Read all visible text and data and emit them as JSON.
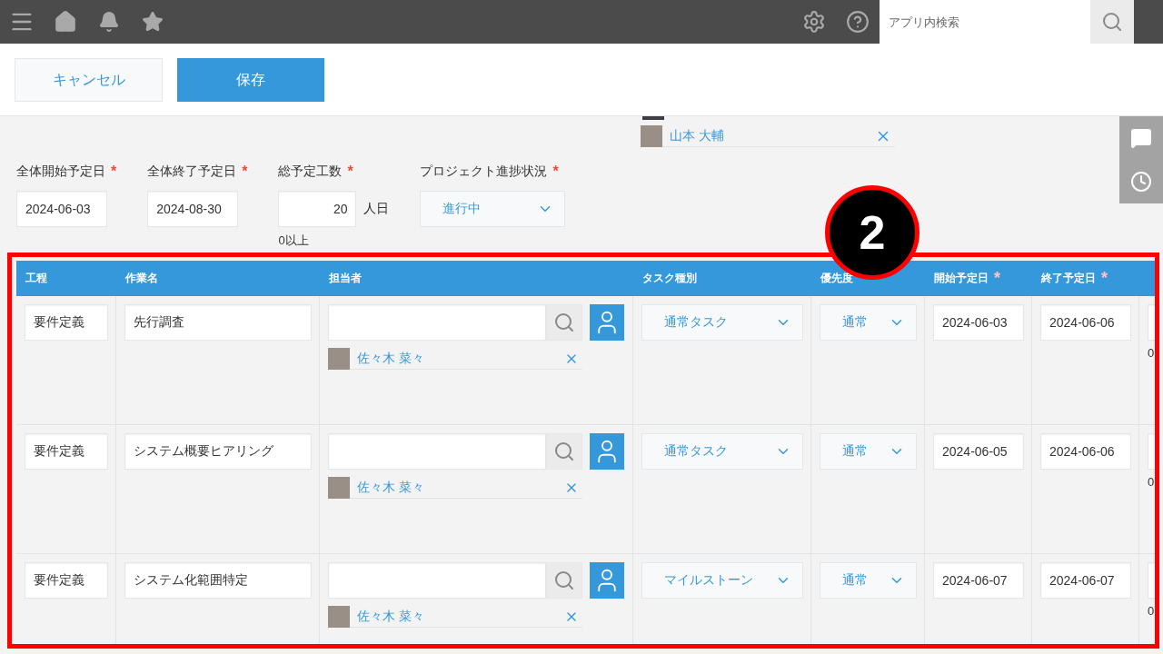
{
  "topbar": {
    "search": {
      "placeholder": "アプリ内検索"
    }
  },
  "actions": {
    "cancel": "キャンセル",
    "save": "保存"
  },
  "members": [
    {
      "name": "山本 大輔"
    }
  ],
  "fields": [
    {
      "kind": "date",
      "label": "全体開始予定日",
      "required_mark": "*",
      "value": "2024-06-03"
    },
    {
      "kind": "date",
      "label": "全体終了予定日",
      "required_mark": "*",
      "value": "2024-08-30"
    },
    {
      "kind": "number",
      "label": "総予定工数",
      "required_mark": "*",
      "value": "20",
      "unit": "人日",
      "hint": "0以上"
    },
    {
      "kind": "select",
      "label": "プロジェクト進捗状況",
      "required_mark": "*",
      "value": "進行中"
    }
  ],
  "annotation": {
    "number": "2"
  },
  "table": {
    "columns": [
      {
        "label": "工程"
      },
      {
        "label": "作業名"
      },
      {
        "label": "担当者"
      },
      {
        "label": "タスク種別"
      },
      {
        "label": "優先度"
      },
      {
        "label": "開始予定日",
        "required_mark": "*"
      },
      {
        "label": "終了予定日",
        "required_mark": "*"
      }
    ],
    "rows": [
      {
        "process": "要件定義",
        "task": "先行調査",
        "assignees": [
          {
            "name": "佐々木 菜々"
          }
        ],
        "task_type": "通常タスク",
        "priority": "通常",
        "start": "2024-06-03",
        "end": "2024-06-06",
        "column_8": {
          "hint": "0"
        }
      },
      {
        "process": "要件定義",
        "task": "システム概要ヒアリング",
        "assignees": [
          {
            "name": "佐々木 菜々"
          }
        ],
        "task_type": "通常タスク",
        "priority": "通常",
        "start": "2024-06-05",
        "end": "2024-06-06",
        "column_8": {
          "hint": "0"
        }
      },
      {
        "process": "要件定義",
        "task": "システム化範囲特定",
        "assignees": [
          {
            "name": "佐々木 菜々"
          }
        ],
        "task_type": "マイルストーン",
        "priority": "通常",
        "start": "2024-06-07",
        "end": "2024-06-07",
        "column_8": {
          "hint": "0"
        }
      }
    ]
  }
}
